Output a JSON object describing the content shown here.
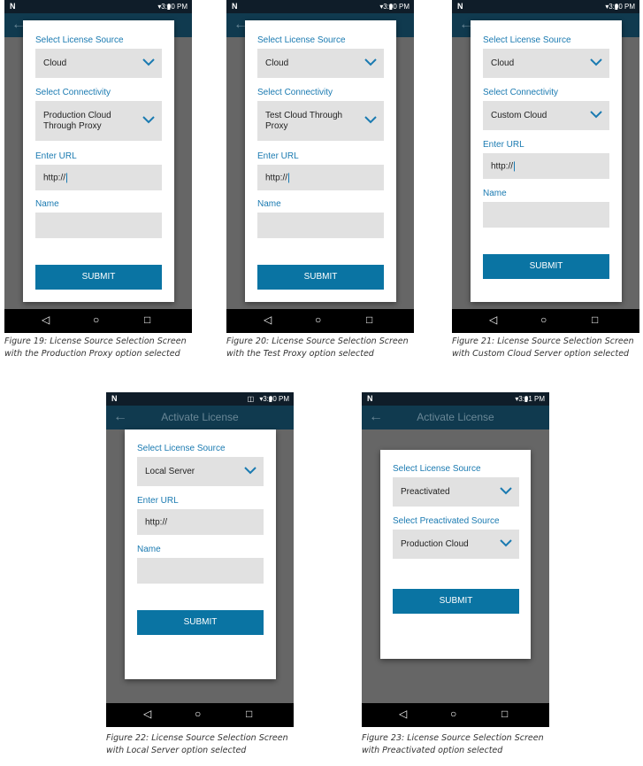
{
  "status_time_1": "3:00 PM",
  "status_time_5": "3:01 PM",
  "app_title": "Activate License",
  "labels": {
    "license_source": "Select License Source",
    "connectivity": "Select Connectivity",
    "enter_url": "Enter URL",
    "name": "Name",
    "preactivated_source": "Select Preactivated Source"
  },
  "submit_label": "SUBMIT",
  "url_value": "http://",
  "fig19": {
    "source": "Cloud",
    "connectivity_line1": "Production Cloud",
    "connectivity_line2": "Through Proxy",
    "caption_line1": "Figure 19: License Source Selection Screen",
    "caption_line2": "with the Production Proxy option selected"
  },
  "fig20": {
    "source": "Cloud",
    "connectivity_line1": "Test Cloud Through",
    "connectivity_line2": "Proxy",
    "caption_line1": "Figure 20: License Source Selection Screen",
    "caption_line2": "with the Test Proxy option selected"
  },
  "fig21": {
    "source": "Cloud",
    "connectivity": "Custom Cloud",
    "caption_line1": "Figure 21: License Source Selection Screen",
    "caption_line2": "with Custom Cloud Server option selected"
  },
  "fig22": {
    "source": "Local Server",
    "caption_line1": "Figure 22: License Source Selection Screen",
    "caption_line2": "with Local Server option selected"
  },
  "fig23": {
    "source": "Preactivated",
    "preactivated_source": "Production Cloud",
    "caption_line1": "Figure 23: License Source Selection Screen",
    "caption_line2": "with Preactivated option selected"
  },
  "icons": {
    "back": "back-arrow-icon",
    "chevron": "chevron-down-icon",
    "nav_back": "triangle-back-icon",
    "nav_home": "circle-home-icon",
    "nav_recents": "square-recents-icon"
  },
  "colors": {
    "accent": "#0a74a3",
    "label": "#1a7ab1",
    "field": "#e1e1e1",
    "appbar": "#103a4f",
    "overlay": "#666666"
  }
}
